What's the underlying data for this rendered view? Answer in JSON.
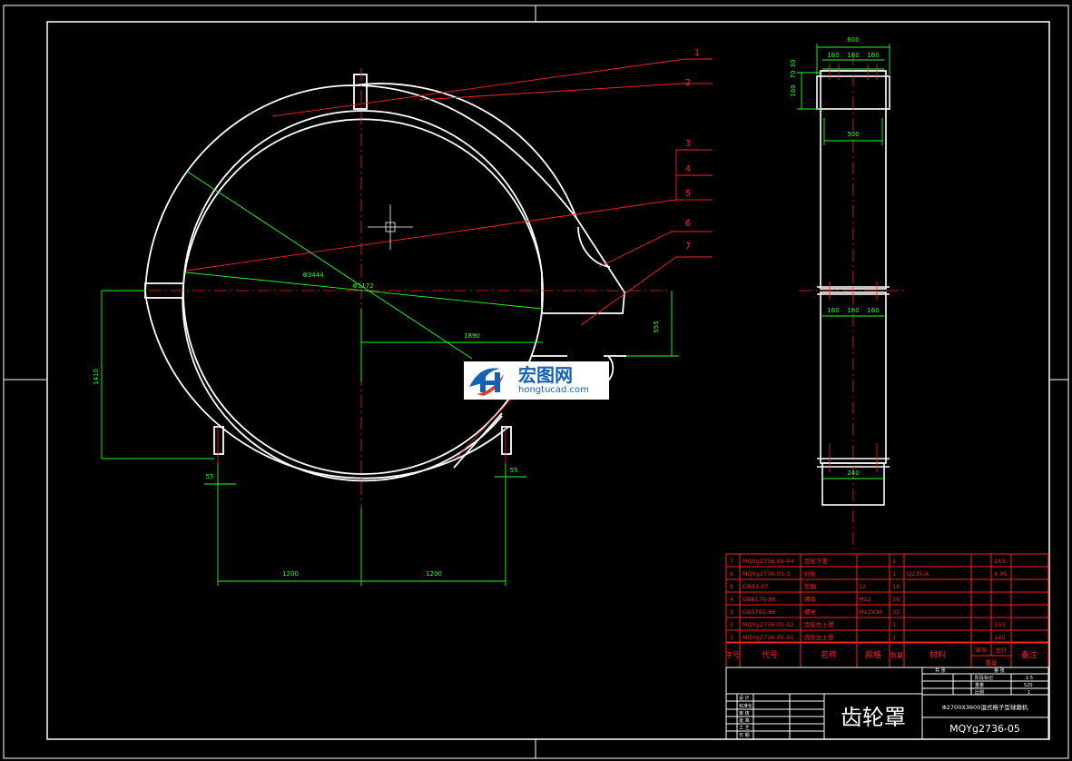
{
  "drawing": {
    "title": "齿轮罩",
    "drawing_number": "MQYg2736-05",
    "project": "Φ2700X3600湿式格子型球磨机"
  },
  "part_labels": [
    "1",
    "2",
    "3",
    "4",
    "5",
    "6",
    "7"
  ],
  "dimensions": {
    "front": {
      "d_outer": "Φ3444",
      "d_inner": "Φ1172",
      "d1890": "1890",
      "d555": "555",
      "d1410": "1410",
      "d55_left": "55",
      "d55_right": "55",
      "d1200_left": "1200",
      "d1200_right": "1200"
    },
    "side": {
      "d600": "600",
      "d160a": "160",
      "d160b": "160",
      "d160c": "160",
      "d160v": "160",
      "d70v": "70",
      "d30v": "30",
      "d500": "500",
      "d160d": "160",
      "d160e": "160",
      "d160f": "160",
      "d240": "240"
    }
  },
  "parts_table": {
    "rows": [
      {
        "no": "7",
        "code": "MQYg2736-05-04",
        "name": "齿轮下罩",
        "qty": "1",
        "material": "",
        "weight": "243"
      },
      {
        "no": "6",
        "code": "MQYg2736-05-3",
        "name": "衬板",
        "qty": "1",
        "material": "Q235-A",
        "weight": "4.95"
      },
      {
        "no": "5",
        "code": "GB93-87",
        "name": "垫圈",
        "qty": "16",
        "material": "",
        "weight": "",
        "spec": "12"
      },
      {
        "no": "4",
        "code": "GB6170-86",
        "name": "螺母",
        "qty": "16",
        "material": "",
        "weight": "",
        "spec": "M12"
      },
      {
        "no": "3",
        "code": "GB5782-86",
        "name": "螺栓",
        "qty": "32",
        "material": "",
        "weight": "",
        "spec": "M12X30"
      },
      {
        "no": "2",
        "code": "MQYg2736-05-02",
        "name": "齿轮右上罩",
        "qty": "1",
        "material": "",
        "weight": "133"
      },
      {
        "no": "1",
        "code": "MQYg2736-05-01",
        "name": "齿轮左上罩",
        "qty": "1",
        "material": "",
        "weight": "145"
      }
    ],
    "headers": {
      "no": "序号",
      "code": "代号",
      "name": "名称",
      "spec": "规格",
      "qty": "数量",
      "material": "材料",
      "single": "单件",
      "total": "总计",
      "weight": "重量",
      "remark": "备注"
    }
  },
  "title_block": {
    "mini": [
      "设 计",
      "标准化",
      "审 核",
      "批 准",
      "工 艺",
      "日 期"
    ],
    "stage_label": "阶段标记",
    "weight_label": "重量",
    "ratio_label": "比例",
    "weight": "520",
    "ratio": "1:5",
    "sheet": "1",
    "sheet_label": "共   张",
    "sheet_label2": "第   张"
  },
  "watermark": {
    "cn": "宏图网",
    "en": "hongtucad.com"
  },
  "colors": {
    "outline": "#ffffff",
    "center": "#ff2020",
    "dimension": "#20ff20",
    "table": "#ff2020",
    "logo": "#1560b8"
  }
}
